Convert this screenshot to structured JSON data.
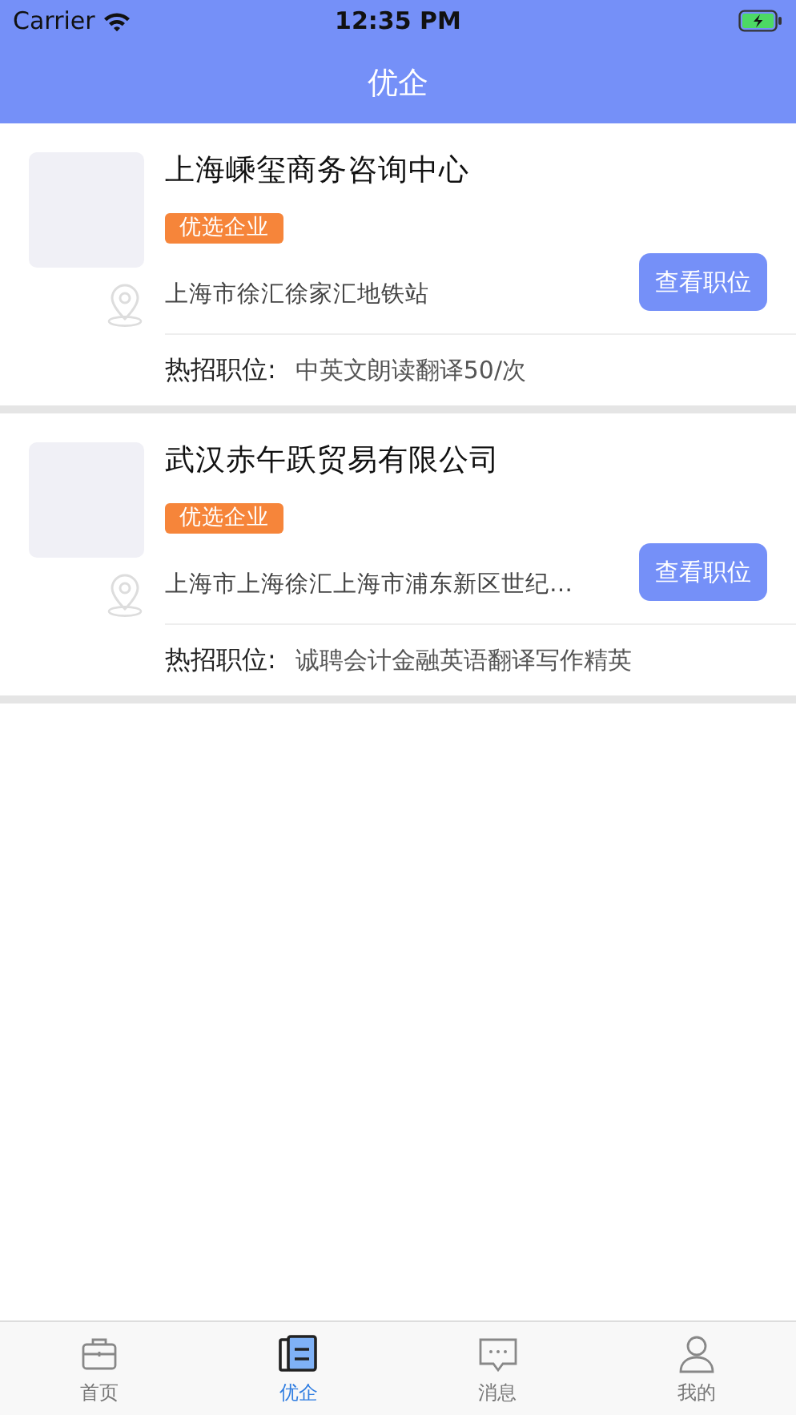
{
  "status_bar": {
    "carrier": "Carrier",
    "time": "12:35 PM"
  },
  "nav": {
    "title": "优企"
  },
  "companies": [
    {
      "name": "上海嵊玺商务咨询中心",
      "badge": "优选企业",
      "address": "上海市徐汇徐家汇地铁站",
      "button": "查看职位",
      "hot_label": "热招职位:",
      "hot_jobs": "中英文朗读翻译50/次"
    },
    {
      "name": "武汉赤午跃贸易有限公司",
      "badge": "优选企业",
      "address": "上海市上海徐汇上海市浦东新区世纪…",
      "button": "查看职位",
      "hot_label": "热招职位:",
      "hot_jobs": "诚聘会计金融英语翻译写作精英"
    }
  ],
  "tab_bar": [
    {
      "label": "首页",
      "selected": false
    },
    {
      "label": "优企",
      "selected": true
    },
    {
      "label": "消息",
      "selected": false
    },
    {
      "label": "我的",
      "selected": false
    }
  ]
}
